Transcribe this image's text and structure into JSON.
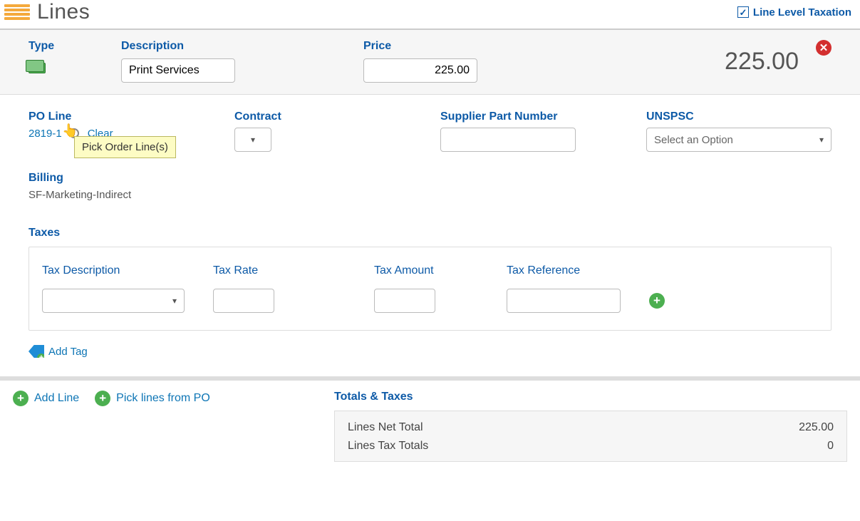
{
  "section": {
    "title": "Lines",
    "line_level_taxation_label": "Line Level Taxation",
    "line_level_taxation_checked": true
  },
  "line": {
    "type_label": "Type",
    "description_label": "Description",
    "description_value": "Print Services",
    "price_label": "Price",
    "price_value": "225.00",
    "total": "225.00"
  },
  "detail": {
    "po_line_label": "PO Line",
    "po_line_value": "2819-1",
    "clear_label": "Clear",
    "tooltip": "Pick Order Line(s)",
    "contract_label": "Contract",
    "supplier_part_number_label": "Supplier Part Number",
    "unspsc_label": "UNSPSC",
    "unspsc_placeholder": "Select an Option",
    "billing_label": "Billing",
    "billing_value": "SF-Marketing-Indirect"
  },
  "taxes": {
    "label": "Taxes",
    "tax_description_label": "Tax Description",
    "tax_rate_label": "Tax Rate",
    "tax_amount_label": "Tax Amount",
    "tax_reference_label": "Tax Reference"
  },
  "tags": {
    "add_tag_label": "Add Tag"
  },
  "footer": {
    "add_line_label": "Add Line",
    "pick_lines_label": "Pick lines from PO"
  },
  "totals": {
    "title": "Totals & Taxes",
    "lines_net_total_label": "Lines Net Total",
    "lines_net_total_value": "225.00",
    "lines_tax_totals_label": "Lines Tax Totals",
    "lines_tax_totals_value": "0"
  }
}
